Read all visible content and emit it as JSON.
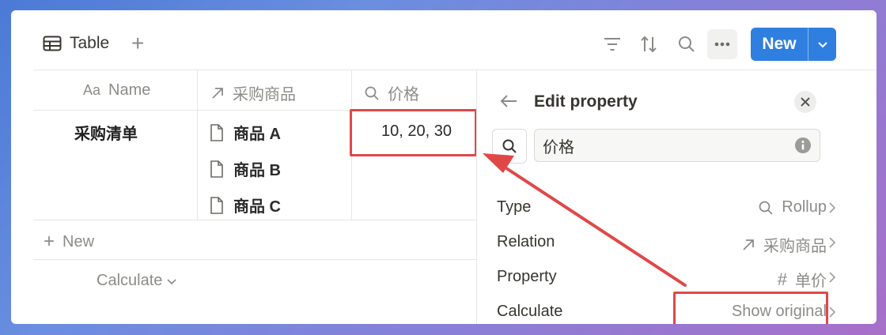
{
  "toolbar": {
    "view_name": "Table",
    "add_view": "+",
    "new_button": "New"
  },
  "table": {
    "columns": [
      {
        "icon_text": "Aa",
        "label": "Name"
      },
      {
        "icon": "arrow-up-right-icon",
        "label": "采购商品"
      },
      {
        "icon": "search-icon",
        "label": "价格"
      }
    ],
    "rows": [
      {
        "name": "采购清单",
        "items": [
          "商品 A",
          "商品 B",
          "商品 C"
        ],
        "price": "10, 20, 30"
      }
    ],
    "new_row": "New",
    "calculate": "Calculate"
  },
  "edit_property": {
    "title": "Edit property",
    "name_value": "价格",
    "rows": [
      {
        "label": "Type",
        "icon": "search-icon",
        "value": "Rollup"
      },
      {
        "label": "Relation",
        "icon": "arrow-up-right-icon",
        "value": "采购商品"
      },
      {
        "label": "Property",
        "icon": "hash-icon",
        "value": "单价"
      },
      {
        "label": "Calculate",
        "icon": "",
        "value": "Show original"
      }
    ]
  },
  "colors": {
    "accent": "#2f7fe0",
    "highlight": "#e04848"
  }
}
